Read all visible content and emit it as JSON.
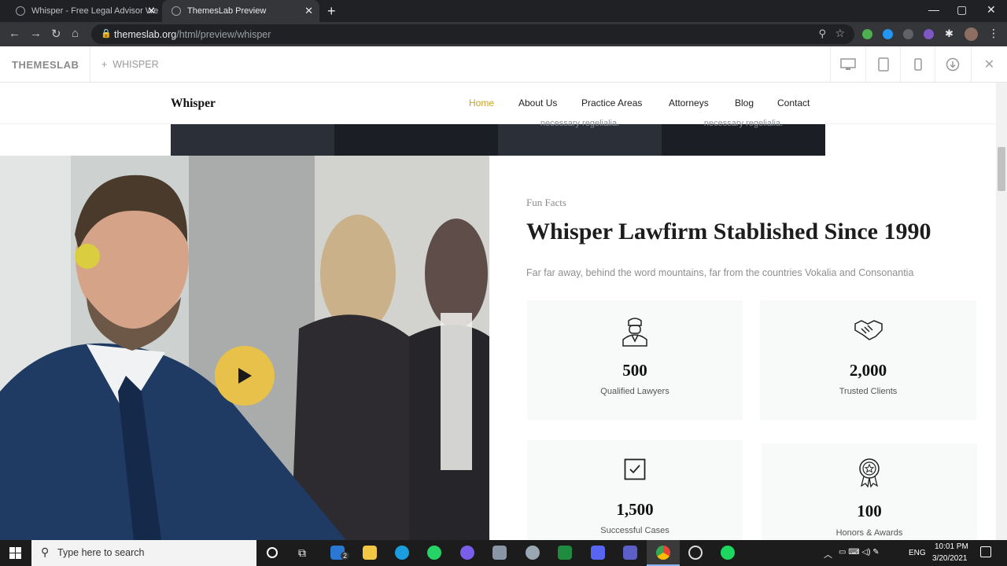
{
  "browser": {
    "tabs": [
      {
        "title": "Whisper - Free Legal Advisor We"
      },
      {
        "title": "ThemesLab Preview"
      }
    ],
    "url_host": "themeslab.org",
    "url_path": "/html/preview/whisper"
  },
  "themeslab_bar": {
    "logo": "THEMESLAB",
    "plus": "+",
    "theme_name": "WHISPER"
  },
  "site": {
    "brand": "Whisper",
    "nav": [
      {
        "label": "Home",
        "active": true
      },
      {
        "label": "About Us"
      },
      {
        "label": "Practice Areas"
      },
      {
        "label": "Attorneys"
      },
      {
        "label": "Blog"
      },
      {
        "label": "Contact"
      }
    ],
    "strip_text": [
      "",
      "",
      "necessary regelialia.",
      "necessary regelialia."
    ]
  },
  "fun_facts": {
    "kicker": "Fun Facts",
    "title": "Whisper Lawfirm Stablished Since 1990",
    "description": "Far far away, behind the word mountains, far from the countries Vokalia and Consonantia",
    "stats": [
      {
        "value": "500",
        "label": "Qualified Lawyers",
        "icon": "lawyer-icon"
      },
      {
        "value": "2,000",
        "label": "Trusted Clients",
        "icon": "handshake-icon"
      },
      {
        "value": "1,500",
        "label": "Successful Cases",
        "icon": "checkbox-icon"
      },
      {
        "value": "100",
        "label": "Honors & Awards",
        "icon": "award-icon"
      }
    ]
  },
  "taskbar": {
    "search_placeholder": "Type here to search",
    "mail_badge": "2",
    "language": "ENG",
    "time": "10:01 PM",
    "date": "3/20/2021"
  },
  "colors": {
    "accent": "#c9a22b",
    "play_button": "#e8c14a",
    "dark_strip": "#1e2229"
  }
}
